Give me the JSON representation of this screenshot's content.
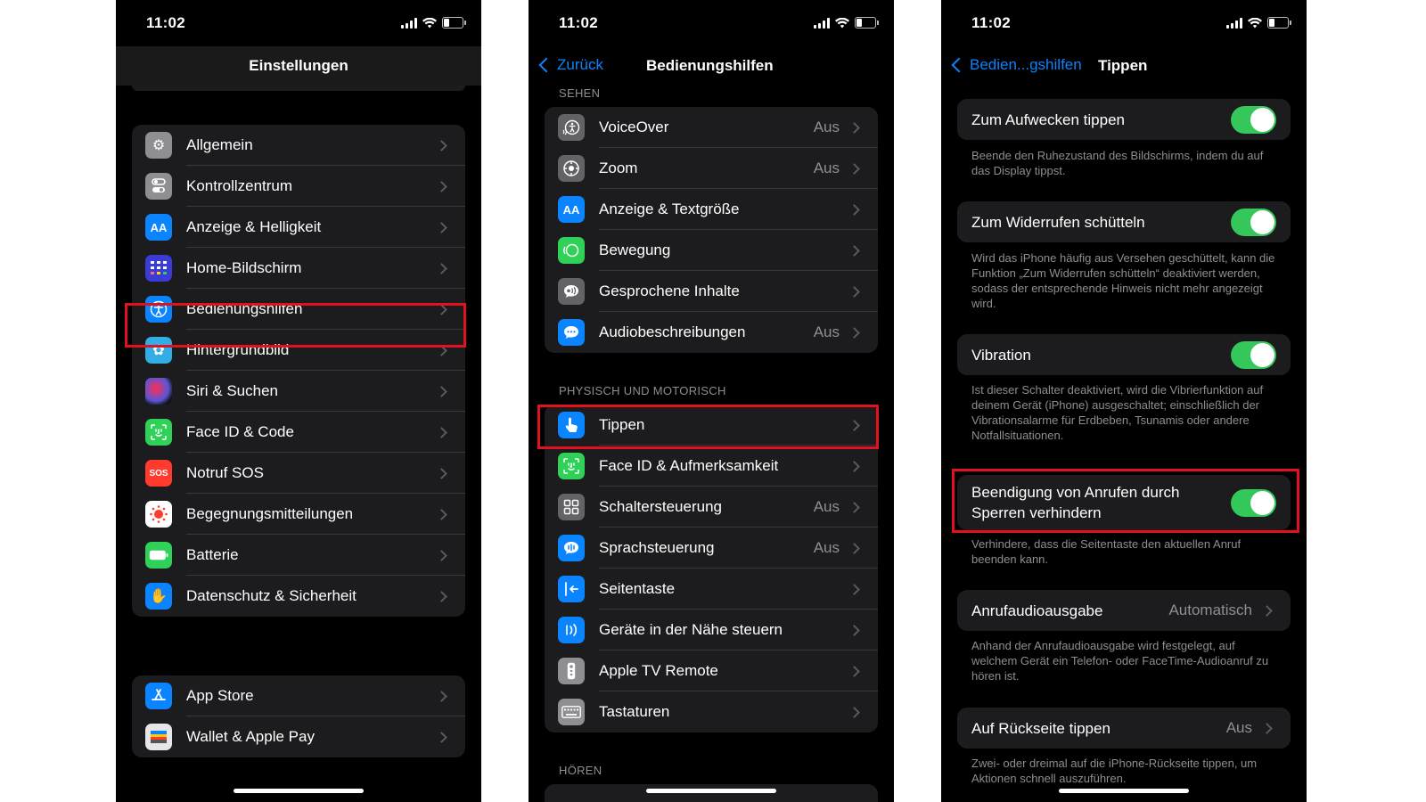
{
  "status": {
    "time": "11:02"
  },
  "p1": {
    "title": "Einstellungen",
    "items": [
      {
        "label": "Allgemein",
        "icon": "gear-icon",
        "color": "#8e8e93"
      },
      {
        "label": "Kontrollzentrum",
        "icon": "switches-icon",
        "color": "#8e8e93"
      },
      {
        "label": "Anzeige & Helligkeit",
        "icon": "text-size-icon",
        "color": "#0a84ff",
        "glyph": "AA"
      },
      {
        "label": "Home-Bildschirm",
        "icon": "home-grid-icon",
        "color": "#3b3bd6"
      },
      {
        "label": "Bedienungshilfen",
        "icon": "accessibility-icon",
        "color": "#0a84ff"
      },
      {
        "label": "Hintergrundbild",
        "icon": "flower-icon",
        "color": "#32ade6"
      },
      {
        "label": "Siri & Suchen",
        "icon": "siri-icon",
        "color": "#222"
      },
      {
        "label": "Face ID & Code",
        "icon": "face-id-icon",
        "color": "#30d158"
      },
      {
        "label": "Notruf SOS",
        "icon": "sos-icon",
        "color": "#ff3b30",
        "glyph": "SOS"
      },
      {
        "label": "Begegnungsmitteilungen",
        "icon": "exposure-icon",
        "color": "#ffffff"
      },
      {
        "label": "Batterie",
        "icon": "battery-icon",
        "color": "#30d158"
      },
      {
        "label": "Datenschutz & Sicherheit",
        "icon": "hand-icon",
        "color": "#0a84ff"
      }
    ],
    "items2": [
      {
        "label": "App Store",
        "icon": "app-store-icon",
        "color": "#0a84ff"
      },
      {
        "label": "Wallet & Apple Pay",
        "icon": "wallet-icon",
        "color": "#2c2c2e"
      }
    ]
  },
  "p2": {
    "back": "Zurück",
    "title": "Bedienungshilfen",
    "sec1": "SEHEN",
    "items1": [
      {
        "label": "VoiceOver",
        "value": "Aus",
        "icon": "voiceover-icon",
        "color": "#636366"
      },
      {
        "label": "Zoom",
        "value": "Aus",
        "icon": "zoom-icon",
        "color": "#636366"
      },
      {
        "label": "Anzeige & Textgröße",
        "value": "",
        "icon": "text-size-icon",
        "color": "#0a84ff",
        "glyph": "AA"
      },
      {
        "label": "Bewegung",
        "value": "",
        "icon": "motion-icon",
        "color": "#30d158"
      },
      {
        "label": "Gesprochene Inhalte",
        "value": "",
        "icon": "speech-icon",
        "color": "#636366"
      },
      {
        "label": "Audiobeschreibungen",
        "value": "Aus",
        "icon": "audio-description-icon",
        "color": "#0a84ff"
      }
    ],
    "sec2": "PHYSISCH UND MOTORISCH",
    "items2": [
      {
        "label": "Tippen",
        "value": "",
        "icon": "touch-icon",
        "color": "#0a84ff"
      },
      {
        "label": "Face ID & Aufmerksamkeit",
        "value": "",
        "icon": "face-id-icon",
        "color": "#30d158"
      },
      {
        "label": "Schaltersteuerung",
        "value": "Aus",
        "icon": "switch-control-icon",
        "color": "#636366"
      },
      {
        "label": "Sprachsteuerung",
        "value": "Aus",
        "icon": "voice-control-icon",
        "color": "#0a84ff"
      },
      {
        "label": "Seitentaste",
        "value": "",
        "icon": "side-button-icon",
        "color": "#0a84ff"
      },
      {
        "label": "Geräte in der Nähe steuern",
        "value": "",
        "icon": "nearby-devices-icon",
        "color": "#0a84ff"
      },
      {
        "label": "Apple TV Remote",
        "value": "",
        "icon": "remote-icon",
        "color": "#8e8e93"
      },
      {
        "label": "Tastaturen",
        "value": "",
        "icon": "keyboard-icon",
        "color": "#8e8e93"
      }
    ],
    "sec3": "HÖREN"
  },
  "p3": {
    "back": "Bedien...gshilfen",
    "title": "Tippen",
    "s1": {
      "label": "Zum Aufwecken tippen",
      "desc": "Beende den Ruhezustand des Bildschirms, indem du auf das Display tippst.",
      "on": true
    },
    "s2": {
      "label": "Zum Widerrufen schütteln",
      "desc": "Wird das iPhone häufig aus Versehen geschüttelt, kann die Funktion „Zum Widerrufen schütteln“ deaktiviert werden, sodass der entsprechende Hinweis nicht mehr angezeigt wird.",
      "on": true
    },
    "s3": {
      "label": "Vibration",
      "desc": "Ist dieser Schalter deaktiviert, wird die Vibrierfunktion auf deinem Gerät (iPhone) ausgeschaltet; einschließlich der Vibrationsalarme für Erdbeben, Tsunamis oder andere Notfallsituationen.",
      "on": true
    },
    "s4": {
      "label1": "Beendigung von Anrufen durch",
      "label2": "Sperren verhindern",
      "desc": "Verhindere, dass die Seitentaste den aktuellen Anruf beenden kann.",
      "on": true
    },
    "s5": {
      "label": "Anrufaudioausgabe",
      "value": "Automatisch",
      "desc": "Anhand der Anrufaudioausgabe wird festgelegt, auf welchem Gerät ein Telefon- oder FaceTime-Audioanruf zu hören ist."
    },
    "s6": {
      "label": "Auf Rückseite tippen",
      "value": "Aus",
      "desc": "Zwei- oder dreimal auf die iPhone-Rückseite tippen, um Aktionen schnell auszuführen."
    }
  }
}
